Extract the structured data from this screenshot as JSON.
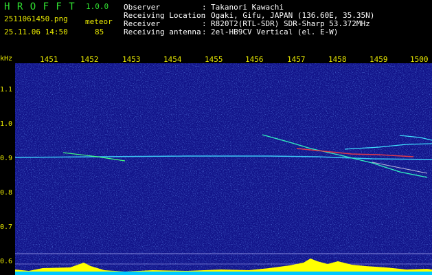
{
  "app": {
    "logo": "H R O F F T",
    "version": "1.0.0",
    "filename": "2511061450.png",
    "datetime": "25.11.06 14:50",
    "mode_label": "meteor",
    "count": "85"
  },
  "info": {
    "rows": [
      {
        "label": "Observer",
        "sep": ":",
        "value": "Takanori Kawachi"
      },
      {
        "label": "Receiving Location",
        "sep": ":",
        "value": "Ogaki, Gifu, JAPAN (136.60E, 35.35N)"
      },
      {
        "label": "Receiver",
        "sep": ":",
        "value": "R820T2(RTL-SDR) SDR-Sharp 53.372MHz"
      },
      {
        "label": "Receiving antenna",
        "sep": ":",
        "value": "2el-HB9CV Vertical (el. E-W)"
      }
    ]
  },
  "axis": {
    "y_unit": "kHz",
    "y_ticks": [
      "1.1",
      "1.0",
      "0.9",
      "0.8",
      "0.7",
      "0.6"
    ],
    "x_ticks": [
      "1451",
      "1452",
      "1453",
      "1454",
      "1455",
      "1456",
      "1457",
      "1458",
      "1459",
      "1500"
    ]
  },
  "colors": {
    "background": "#000000",
    "plot_bg": "#12148a",
    "label_yellow": "#e8e800",
    "label_green": "#31e031",
    "text_white": "#ffffff",
    "signal_cyan": "#00e0ff",
    "signal_green": "#40ff60",
    "signal_red": "#ff3030",
    "level_yellow": "#ffff00"
  }
}
